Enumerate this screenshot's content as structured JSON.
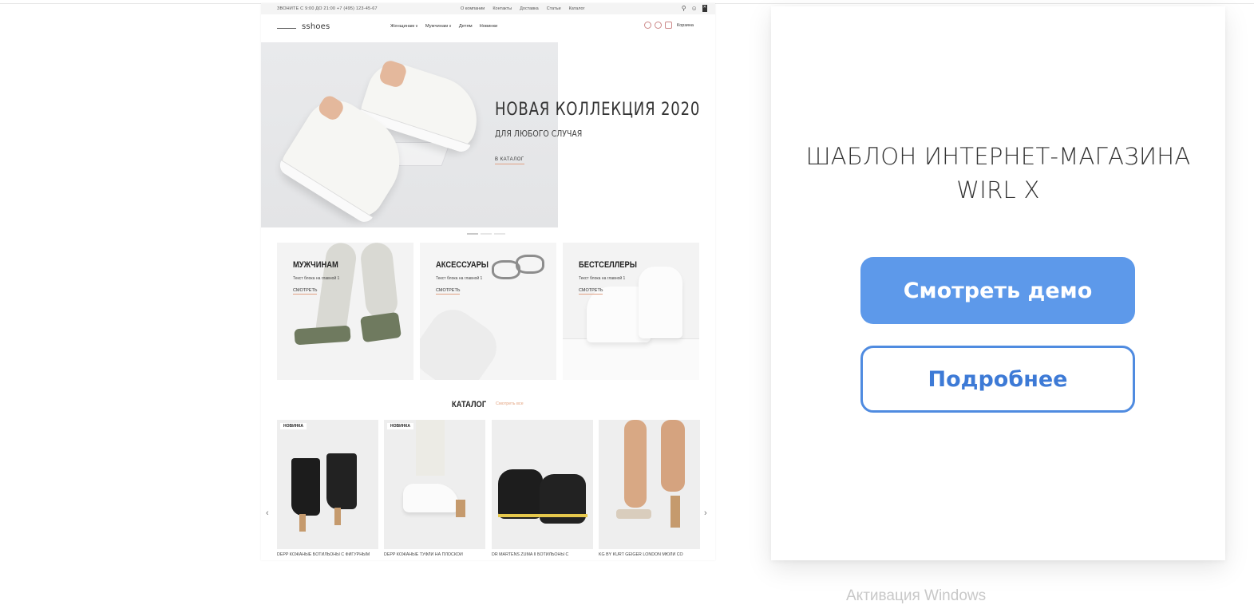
{
  "preview": {
    "topbar": {
      "phone": "ЗВОНИТЕ С 9:00 ДО 21:00    +7 (495) 123-45-67",
      "links": [
        "О компании",
        "Контакты",
        "Доставка",
        "Статьи",
        "Каталог"
      ]
    },
    "header": {
      "logo": "sshoes",
      "nav": [
        {
          "label": "Женщинам",
          "dropdown": true
        },
        {
          "label": "Мужчинам",
          "dropdown": true
        },
        {
          "label": "Детям",
          "dropdown": false
        },
        {
          "label": "Новинки",
          "dropdown": false
        }
      ],
      "cart_label": "Корзина"
    },
    "hero": {
      "title": "НОВАЯ КОЛЛЕКЦИЯ 2020",
      "subtitle": "ДЛЯ ЛЮБОГО СЛУЧАЯ",
      "link": "В КАТАЛОГ",
      "slides": 3,
      "active_slide": 1
    },
    "categories": [
      {
        "title": "МУЖЧИНАМ",
        "text": "Текст блока на главной 1",
        "link": "СМОТРЕТЬ"
      },
      {
        "title": "АКСЕССУАРЫ",
        "text": "Текст блока на главной 1",
        "link": "СМОТРЕТЬ"
      },
      {
        "title": "БЕСТСЕЛЛЕРЫ",
        "text": "Текст блока на главной 1",
        "link": "СМОТРЕТЬ"
      }
    ],
    "catalog": {
      "title": "КАТАЛОГ",
      "link": "Смотреть все",
      "products": [
        {
          "badge": "НОВИНКА",
          "name": "DEPP КОЖАНЫЕ БОТИЛЬОНЫ С ФИГУРНЫМ"
        },
        {
          "badge": "НОВИНКА",
          "name": "DEPP КОЖАНЫЕ ТУФЛИ НА ПЛОСКОЙ"
        },
        {
          "badge": "",
          "name": "DR MARTENS ZUMA II БОТИЛЬОНЫ С"
        },
        {
          "badge": "",
          "name": "KG BY KURT GEIGER LONDON МЮЛИ СО"
        }
      ],
      "prev_arrow": "‹",
      "next_arrow": "›"
    }
  },
  "card": {
    "title_line1": "ШАБЛОН ИНТЕРНЕТ-МАГАЗИНА",
    "title_line2": "WIRL X",
    "demo_button": "Смотреть демо",
    "more_button": "Подробнее"
  },
  "watermark": "Активация Windows",
  "colors": {
    "primary_button": "#5d99ea",
    "outline_button": "#4f8be0",
    "accent_underline": "#e0a083"
  }
}
